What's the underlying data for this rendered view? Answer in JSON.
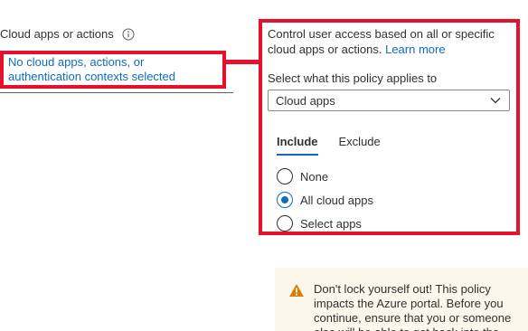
{
  "left": {
    "label": "Cloud apps or actions",
    "selection_link": "No cloud apps, actions, or authentication contexts selected"
  },
  "panel": {
    "description": "Control user access based on all or specific cloud apps or actions.",
    "learn_more": "Learn more",
    "applies_label": "Select what this policy applies to",
    "dropdown_value": "Cloud apps",
    "tabs": [
      {
        "label": "Include",
        "active": true
      },
      {
        "label": "Exclude",
        "active": false
      }
    ],
    "options": [
      {
        "label": "None",
        "checked": false
      },
      {
        "label": "All cloud apps",
        "checked": true
      },
      {
        "label": "Select apps",
        "checked": false
      }
    ]
  },
  "warning": {
    "icon": "warning-triangle-icon",
    "text": "Don't lock yourself out! This policy impacts the Azure portal. Before you continue, ensure that you or someone else will be able to get back into the"
  },
  "colors": {
    "highlight": "#e8112d",
    "link": "#0f6cbd",
    "warning_bg": "#fdf6ea",
    "warning_icon": "#d67f0a"
  }
}
